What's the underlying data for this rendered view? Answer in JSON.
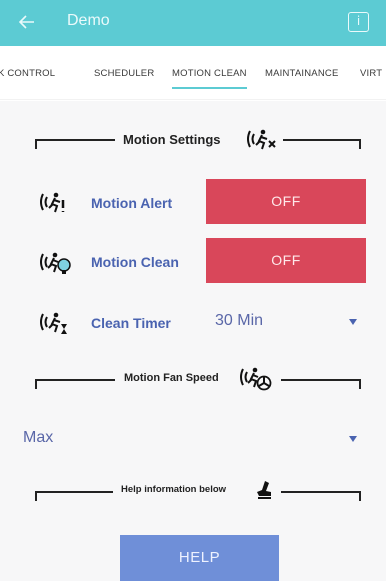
{
  "appbar": {
    "title": "Demo",
    "back_icon": "arrow-left-icon",
    "info_icon": "info-icon",
    "info_glyph": "i",
    "color": "#5ccbd3"
  },
  "tabs": [
    {
      "label": "K CONTROL",
      "active": false
    },
    {
      "label": "SCHEDULER",
      "active": false
    },
    {
      "label": "MOTION CLEAN",
      "active": true
    },
    {
      "label": "MAINTAINANCE",
      "active": false
    },
    {
      "label": "VIRT",
      "active": false
    }
  ],
  "motion_settings": {
    "header": "Motion Settings",
    "motion_alert": {
      "label": "Motion Alert",
      "value": "OFF"
    },
    "motion_clean": {
      "label": "Motion Clean",
      "value": "OFF"
    },
    "clean_timer": {
      "label": "Clean Timer",
      "value": "30 Min"
    }
  },
  "fan_speed": {
    "header": "Motion Fan Speed",
    "value": "Max"
  },
  "help": {
    "header": "Help information below",
    "button_label": "HELP"
  },
  "colors": {
    "accent": "#5ccbd3",
    "off_button": "#d9475a",
    "label_blue": "#4a63b0",
    "help_button": "#6f8fd8"
  }
}
